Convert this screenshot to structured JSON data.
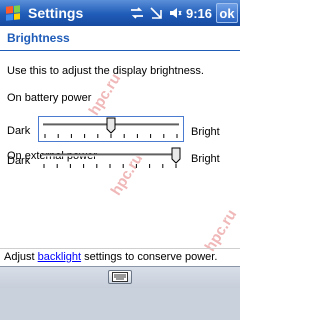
{
  "titlebar": {
    "app_title": "Settings",
    "time": "9:16",
    "ok_label": "ok",
    "icons": [
      "start-flag-icon",
      "connectivity-icon",
      "signal-off-icon",
      "speaker-icon"
    ]
  },
  "page": {
    "title": "Brightness",
    "intro": "Use this to adjust the display brightness.",
    "battery": {
      "label": "On battery power",
      "min_label": "Dark",
      "max_label": "Bright",
      "level_percent": 50
    },
    "external": {
      "label": "On external power",
      "min_label": "Dark",
      "max_label": "Bright",
      "level_percent": 100
    }
  },
  "watermark": "hpc.ru",
  "footer": {
    "prefix": "Adjust ",
    "link": "backlight",
    "suffix": " settings to conserve power."
  },
  "menubar": {
    "sip_icon": "keyboard-icon"
  },
  "colors": {
    "accent": "#1f5cb8",
    "link": "#0000ff",
    "watermark": "#f0b8b8"
  }
}
